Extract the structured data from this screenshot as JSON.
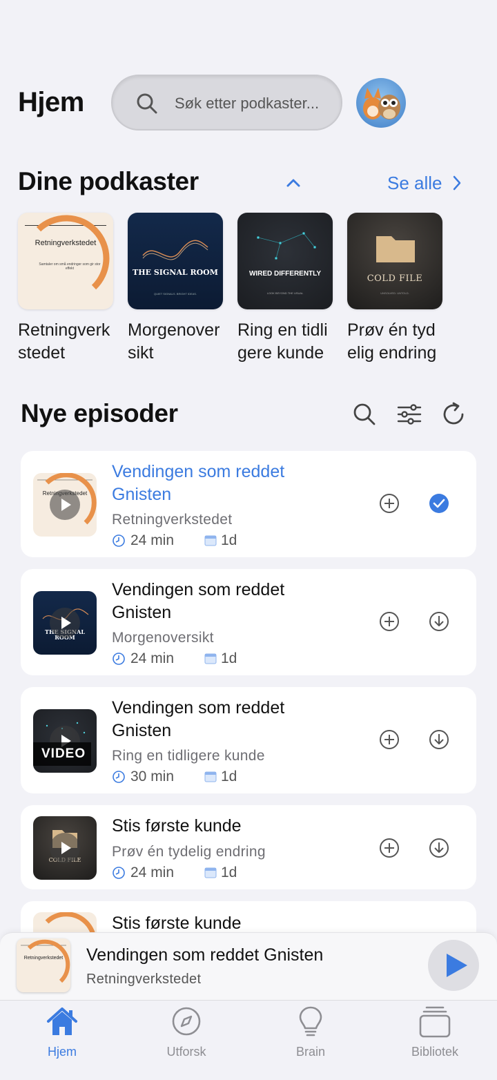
{
  "header": {
    "title": "Hjem",
    "search_placeholder": "Søk etter podkaster..."
  },
  "podcasts_section": {
    "title": "Dine podkaster",
    "see_all_label": "Se alle",
    "items": [
      {
        "name": "Retningverkstedet",
        "art_text": "Retningverkstedet",
        "art_sub": "Samtaler om små endringer som gir stor effekt"
      },
      {
        "name": "Morgenoversikt",
        "art_text": "THE SIGNAL ROOM",
        "art_sub": "QUIET SIGNALS. BRIGHT IDEAS."
      },
      {
        "name": "Ring en tidligere kunde",
        "art_text": "WIRED DIFFERENTLY",
        "art_sub": "LOOK BEYOND THE USUAL"
      },
      {
        "name": "Prøv én tydelig endring",
        "art_text": "COLD FILE",
        "art_sub": "UNSOLVED. UNTOLD."
      }
    ]
  },
  "episodes_section": {
    "title": "Nye episoder",
    "items": [
      {
        "title": "Vendingen som reddet Gnisten",
        "podcast": "Retningverkstedet",
        "duration": "24 min",
        "age": "1d",
        "active": true,
        "status": "done"
      },
      {
        "title": "Vendingen som reddet Gnisten",
        "podcast": "Morgenoversikt",
        "duration": "24 min",
        "age": "1d",
        "active": false,
        "status": "download"
      },
      {
        "title": "Vendingen som reddet Gnisten",
        "podcast": "Ring en tidligere kunde",
        "duration": "30 min",
        "age": "1d",
        "active": false,
        "status": "download",
        "badge": "VIDEO"
      },
      {
        "title": "Stis første kunde",
        "podcast": "Prøv én tydelig endring",
        "duration": "24 min",
        "age": "1d",
        "active": false,
        "status": "download"
      },
      {
        "title": "Stis første kunde"
      }
    ]
  },
  "mini_player": {
    "title": "Vendingen som reddet Gnisten",
    "podcast": "Retningverkstedet"
  },
  "tabs": [
    {
      "label": "Hjem",
      "active": true
    },
    {
      "label": "Utforsk",
      "active": false
    },
    {
      "label": "Brain",
      "active": false
    },
    {
      "label": "Bibliotek",
      "active": false
    }
  ],
  "colors": {
    "accent": "#3b7be0",
    "background": "#f2f2f7",
    "card": "#ffffff"
  }
}
